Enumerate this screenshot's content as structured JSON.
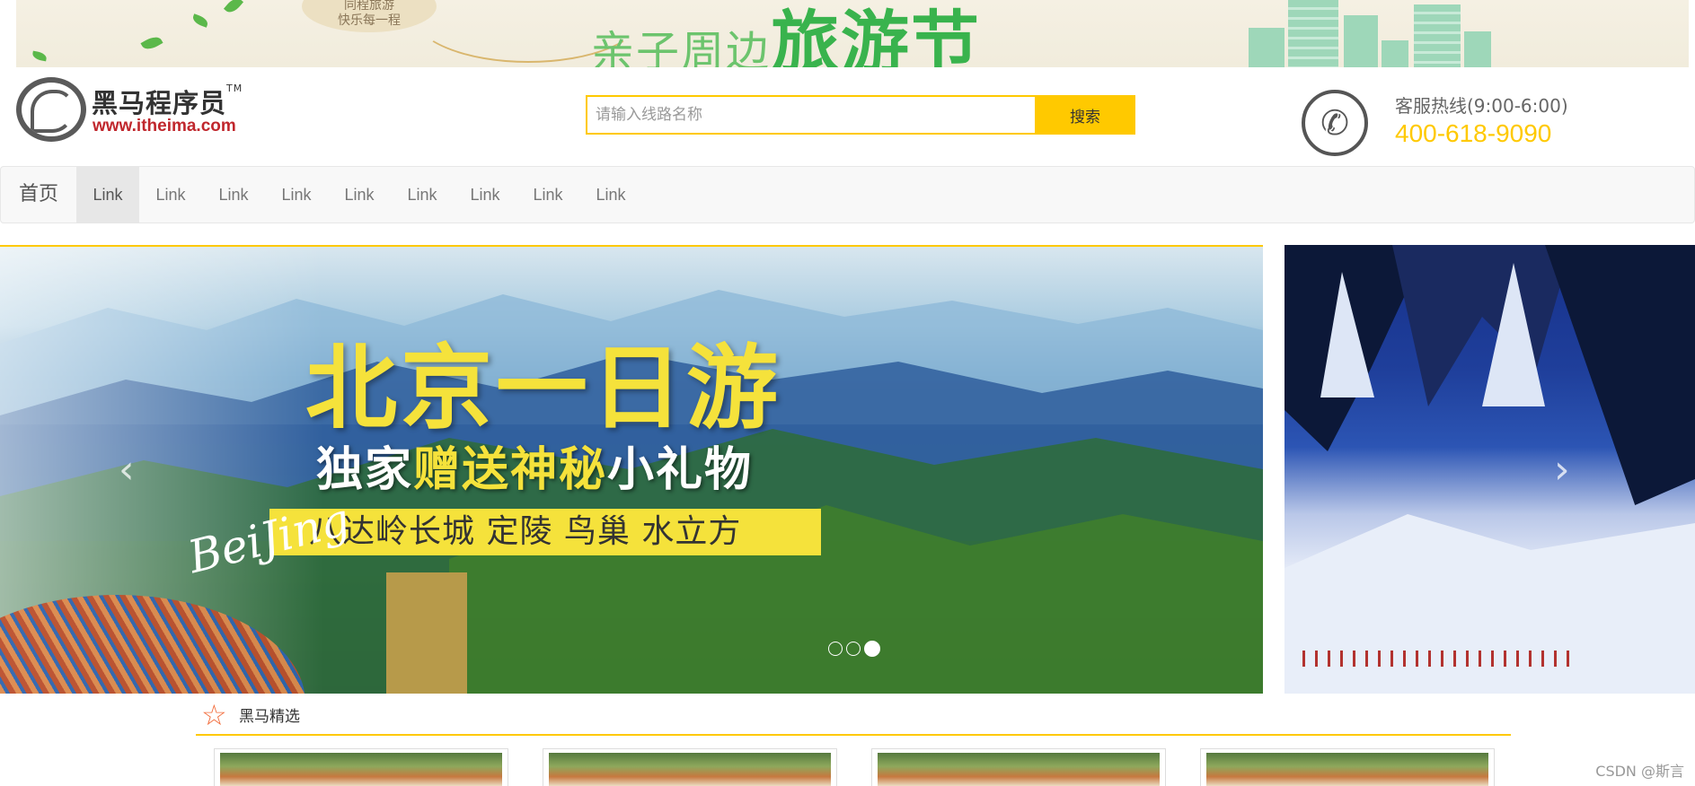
{
  "top_banner": {
    "badge_line1": "同程旅游",
    "badge_line2": "快乐每一程",
    "title_prefix": "亲子周边",
    "title_main": "旅游节"
  },
  "logo": {
    "name": "黑马程序员",
    "trademark": "TM",
    "url": "www.itheima.com"
  },
  "search": {
    "placeholder": "请输入线路名称",
    "value": "",
    "button_label": "搜索"
  },
  "hotline": {
    "label": "客服热线(9:00-6:00)",
    "number": "400-618-9090"
  },
  "navbar": {
    "brand": "首页",
    "links": [
      "Link",
      "Link",
      "Link",
      "Link",
      "Link",
      "Link",
      "Link",
      "Link",
      "Link"
    ],
    "active_index": 0
  },
  "carousel": {
    "slide_title": "北京一日游",
    "slide_subtitle_a": "独家",
    "slide_subtitle_b": "赠送神秘",
    "slide_subtitle_c": "小礼物",
    "slide_sights": "八达岭长城  定陵  鸟巢 水立方",
    "slide_script": "BeiJing",
    "prev_icon": "‹",
    "next_icon": "›",
    "slide_count": 3,
    "active_slide": 3
  },
  "section": {
    "title": "黑马精选",
    "icon": "☆",
    "card_count": 4
  },
  "watermark": "CSDN @斯言",
  "colors": {
    "accent": "#ffc900",
    "brand_red": "#c0272d",
    "nav_bg": "#f8f8f8"
  }
}
